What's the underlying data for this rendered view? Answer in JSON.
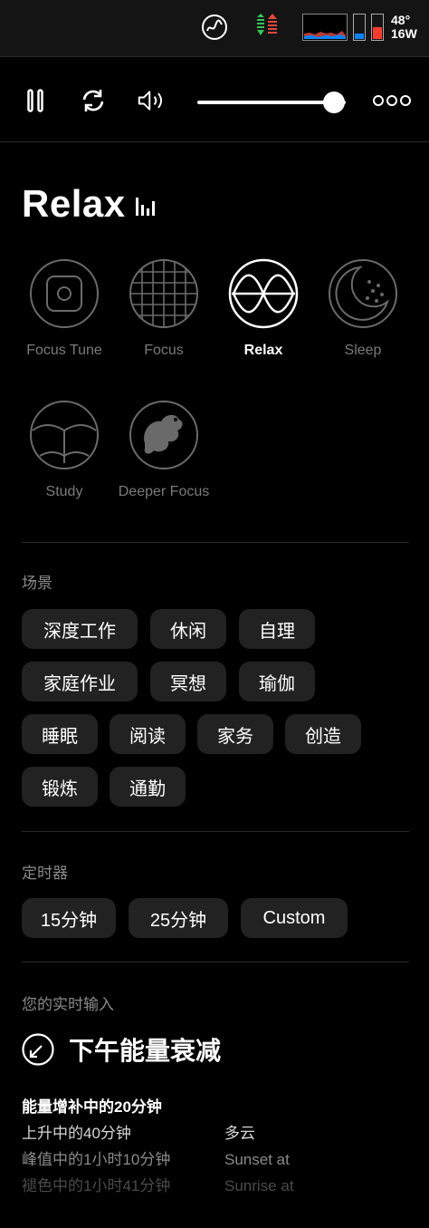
{
  "menubar": {
    "temp": "48°",
    "power": "16W",
    "colors": {
      "arrow_up": "#e5483f",
      "arrow_down": "#34c759",
      "battery_low": "#ff3b30",
      "battery_blue": "#0a84ff"
    }
  },
  "player": {
    "volume_percent": 92
  },
  "mode_title": "Relax",
  "modes": [
    {
      "label": "Focus Tune",
      "active": false
    },
    {
      "label": "Focus",
      "active": false
    },
    {
      "label": "Relax",
      "active": true
    },
    {
      "label": "Sleep",
      "active": false
    },
    {
      "label": "Study",
      "active": false
    },
    {
      "label": "Deeper Focus",
      "active": false
    }
  ],
  "scenes": {
    "label": "场景",
    "chips": [
      "深度工作",
      "休闲",
      "自理",
      "家庭作业",
      "冥想",
      "瑜伽",
      "睡眠",
      "阅读",
      "家务",
      "创造",
      "锻炼",
      "通勤"
    ]
  },
  "timer": {
    "label": "定时器",
    "chips": [
      "15分钟",
      "25分钟",
      "Custom"
    ]
  },
  "insight": {
    "label": "您的实时输入",
    "title": "下午能量衰减",
    "lines_left": [
      "能量增补中的20分钟",
      "上升中的40分钟",
      "峰值中的1小时10分钟",
      "褪色中的1小时41分钟"
    ],
    "lines_right": [
      "多云",
      "Sunset at",
      "Sunrise at"
    ]
  }
}
